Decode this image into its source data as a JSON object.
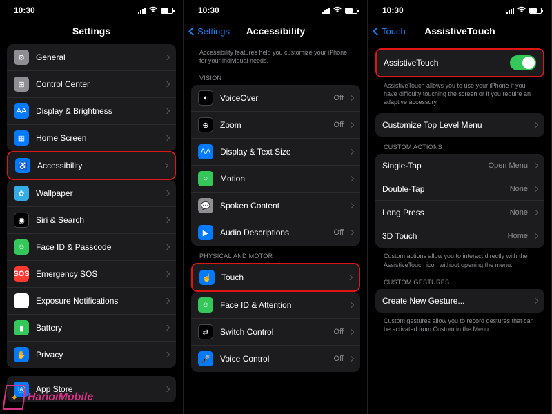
{
  "status": {
    "time": "10:30"
  },
  "screens": [
    {
      "title": "Settings",
      "back": null,
      "groups": [
        {
          "items": [
            {
              "icon": "gear",
              "iconClass": "bg-gray",
              "label": "General"
            },
            {
              "icon": "cc",
              "iconClass": "bg-gray",
              "label": "Control Center"
            },
            {
              "icon": "AA",
              "iconClass": "bg-aa",
              "label": "Display & Brightness"
            },
            {
              "icon": "grid",
              "iconClass": "bg-ind",
              "label": "Home Screen"
            },
            {
              "icon": "acc",
              "iconClass": "bg-blue",
              "label": "Accessibility",
              "highlight": true
            },
            {
              "icon": "flower",
              "iconClass": "bg-cyan",
              "label": "Wallpaper"
            },
            {
              "icon": "siri",
              "iconClass": "bg-dark",
              "label": "Siri & Search"
            },
            {
              "icon": "face",
              "iconClass": "bg-green",
              "label": "Face ID & Passcode"
            },
            {
              "icon": "SOS",
              "iconClass": "bg-sos",
              "label": "Emergency SOS"
            },
            {
              "icon": "exp",
              "iconClass": "bg-white",
              "label": "Exposure Notifications"
            },
            {
              "icon": "batt",
              "iconClass": "bg-green",
              "label": "Battery"
            },
            {
              "icon": "hand",
              "iconClass": "bg-blue",
              "label": "Privacy"
            }
          ]
        },
        {
          "items": [
            {
              "icon": "A",
              "iconClass": "bg-blue",
              "label": "App Store"
            }
          ]
        }
      ]
    },
    {
      "title": "Accessibility",
      "back": "Settings",
      "note_top": "Accessibility features help you customize your iPhone for your individual needs.",
      "groups": [
        {
          "header": "VISION",
          "items": [
            {
              "icon": "vo",
              "iconClass": "bg-dark",
              "label": "VoiceOver",
              "value": "Off"
            },
            {
              "icon": "zoom",
              "iconClass": "bg-dark",
              "label": "Zoom",
              "value": "Off"
            },
            {
              "icon": "AA",
              "iconClass": "bg-aa",
              "label": "Display & Text Size"
            },
            {
              "icon": "motion",
              "iconClass": "bg-green",
              "label": "Motion"
            },
            {
              "icon": "sp",
              "iconClass": "bg-sbubble",
              "label": "Spoken Content"
            },
            {
              "icon": "ad",
              "iconClass": "bg-blue",
              "label": "Audio Descriptions",
              "value": "Off"
            }
          ]
        },
        {
          "header": "PHYSICAL AND MOTOR",
          "items": [
            {
              "icon": "touch",
              "iconClass": "bg-blue",
              "label": "Touch",
              "highlight": true
            },
            {
              "icon": "face",
              "iconClass": "bg-green",
              "label": "Face ID & Attention"
            },
            {
              "icon": "sw",
              "iconClass": "bg-dark",
              "label": "Switch Control",
              "value": "Off"
            },
            {
              "icon": "mic",
              "iconClass": "bg-blue",
              "label": "Voice Control",
              "value": "Off"
            }
          ]
        }
      ]
    },
    {
      "title": "AssistiveTouch",
      "back": "Touch",
      "groups": [
        {
          "items": [
            {
              "label": "AssistiveTouch",
              "toggle": true,
              "highlight": true
            }
          ],
          "note": "AssistiveTouch allows you to use your iPhone if you have difficulty touching the screen or if you require an adaptive accessory."
        },
        {
          "items": [
            {
              "label": "Customize Top Level Menu"
            }
          ]
        },
        {
          "header": "CUSTOM ACTIONS",
          "items": [
            {
              "label": "Single-Tap",
              "value": "Open Menu"
            },
            {
              "label": "Double-Tap",
              "value": "None"
            },
            {
              "label": "Long Press",
              "value": "None"
            },
            {
              "label": "3D Touch",
              "value": "Home"
            }
          ],
          "note": "Custom actions allow you to interact directly with the AssistiveTouch icon without opening the menu."
        },
        {
          "header": "CUSTOM GESTURES",
          "items": [
            {
              "label": "Create New Gesture..."
            }
          ],
          "note": "Custom gestures allow you to record gestures that can be activated from Custom in the Menu."
        }
      ]
    }
  ],
  "watermark": "HanoiMobile"
}
